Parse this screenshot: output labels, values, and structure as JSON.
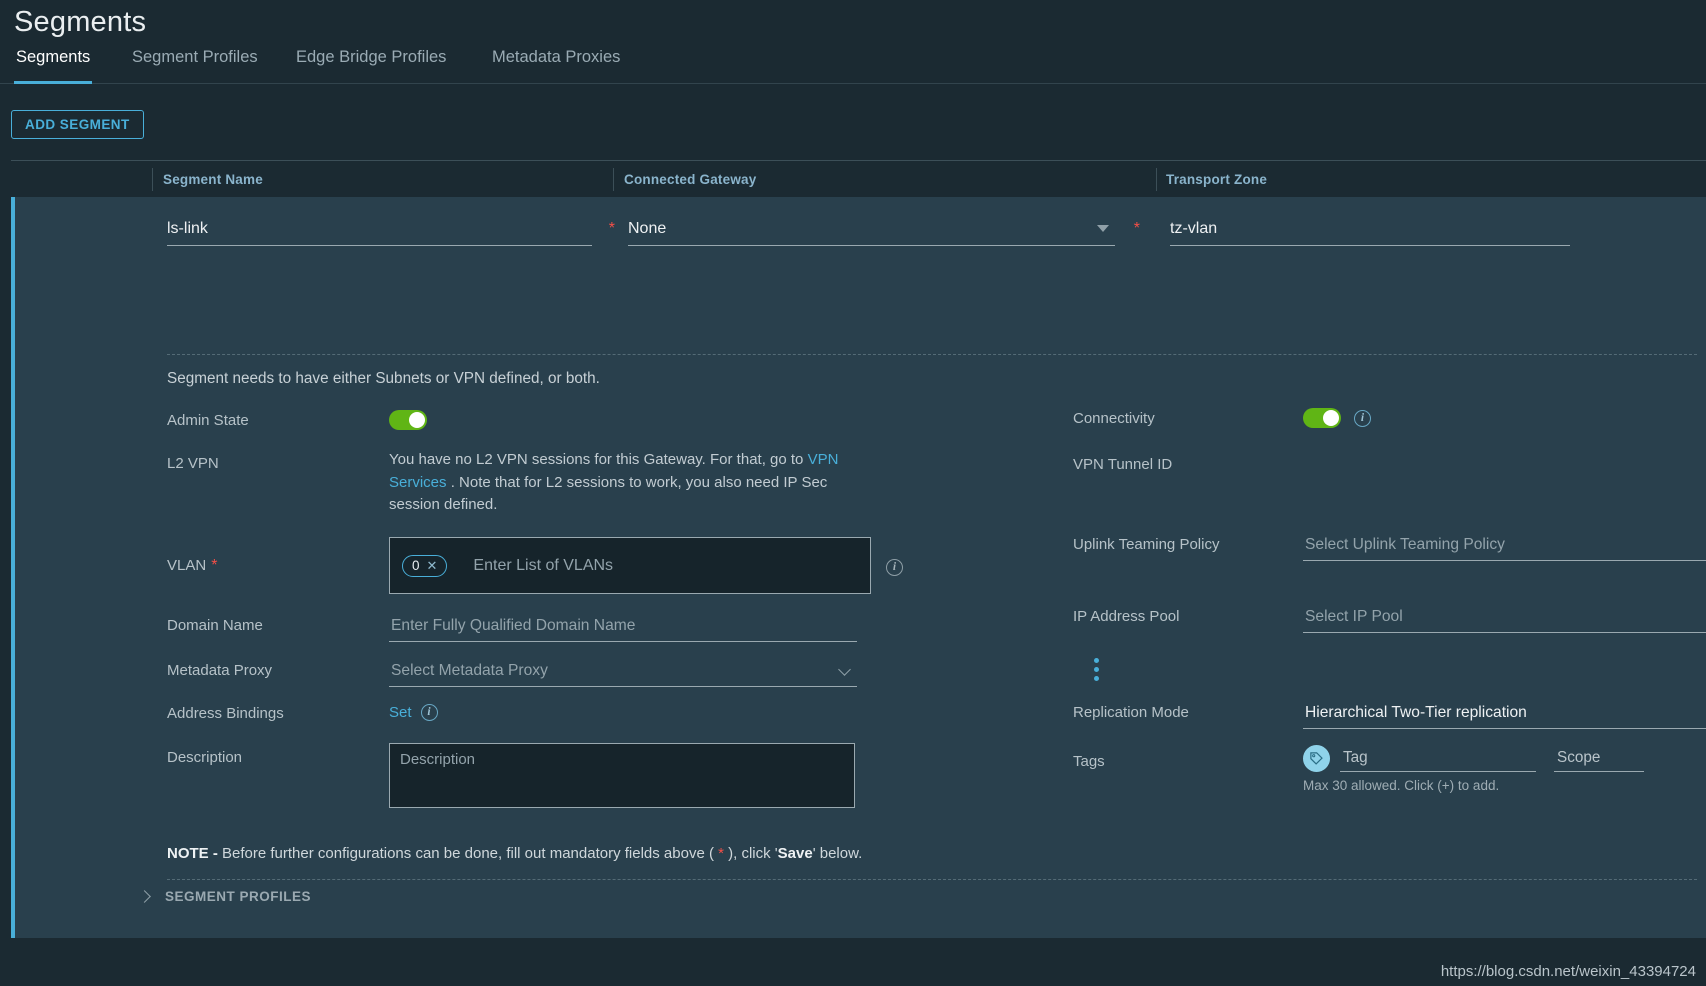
{
  "page": {
    "title": "Segments"
  },
  "tabs": [
    {
      "label": "Segments",
      "active": true
    },
    {
      "label": "Segment Profiles",
      "active": false
    },
    {
      "label": "Edge Bridge Profiles",
      "active": false
    },
    {
      "label": "Metadata Proxies",
      "active": false
    }
  ],
  "toolbar": {
    "add_segment_label": "ADD SEGMENT"
  },
  "grid": {
    "columns": [
      "Segment Name",
      "Connected Gateway",
      "Transport Zone"
    ]
  },
  "row": {
    "segment_name": {
      "value": "ls-link",
      "required": true
    },
    "connected_gateway": {
      "value": "None",
      "required": true
    },
    "transport_zone": {
      "value": "tz-vlan",
      "required": false
    }
  },
  "form": {
    "hint": "Segment needs to have either Subnets or VPN defined, or both.",
    "left": {
      "admin_state": {
        "label": "Admin State",
        "on": true
      },
      "l2vpn": {
        "label": "L2 VPN",
        "text_1": "You have no L2 VPN sessions for this Gateway. For that, go to ",
        "link": "VPN Services",
        "text_2": " . Note that for L2 sessions to work, you also need IP Sec session defined."
      },
      "vlan": {
        "label": "VLAN",
        "required": true,
        "chips": [
          "0"
        ],
        "placeholder": "Enter List of VLANs"
      },
      "domain_name": {
        "label": "Domain Name",
        "placeholder": "Enter Fully Qualified Domain Name",
        "value": ""
      },
      "metadata_proxy": {
        "label": "Metadata Proxy",
        "placeholder": "Select Metadata Proxy",
        "value": ""
      },
      "address_bindings": {
        "label": "Address Bindings",
        "action": "Set"
      },
      "description": {
        "label": "Description",
        "placeholder": "Description",
        "value": ""
      }
    },
    "right": {
      "connectivity": {
        "label": "Connectivity",
        "on": true
      },
      "vpn_tunnel_id": {
        "label": "VPN Tunnel ID",
        "value": ""
      },
      "uplink_teaming_policy": {
        "label": "Uplink Teaming Policy",
        "placeholder": "Select Uplink Teaming Policy",
        "value": ""
      },
      "ip_address_pool": {
        "label": "IP Address Pool",
        "placeholder": "Select IP Pool",
        "value": ""
      },
      "replication_mode": {
        "label": "Replication Mode",
        "value": "Hierarchical Two-Tier replication"
      },
      "tags": {
        "label": "Tags",
        "tag_placeholder": "Tag",
        "scope_placeholder": "Scope",
        "help": "Max 30 allowed. Click (+) to add."
      }
    }
  },
  "note": {
    "prefix": "NOTE - ",
    "text_1": "Before further configurations can be done, fill out mandatory fields above ( ",
    "star": "*",
    "text_2": " ), click '",
    "save": "Save",
    "text_3": "' below."
  },
  "footer": {
    "segment_profiles_label": "SEGMENT PROFILES"
  },
  "watermark": {
    "url": "https://blog.csdn.net/weixin_43394724"
  },
  "colors": {
    "accent": "#49afd9",
    "toggle_on": "#60b515",
    "required": "#f54f47",
    "panel": "#29404d",
    "background": "#1b2a32"
  }
}
